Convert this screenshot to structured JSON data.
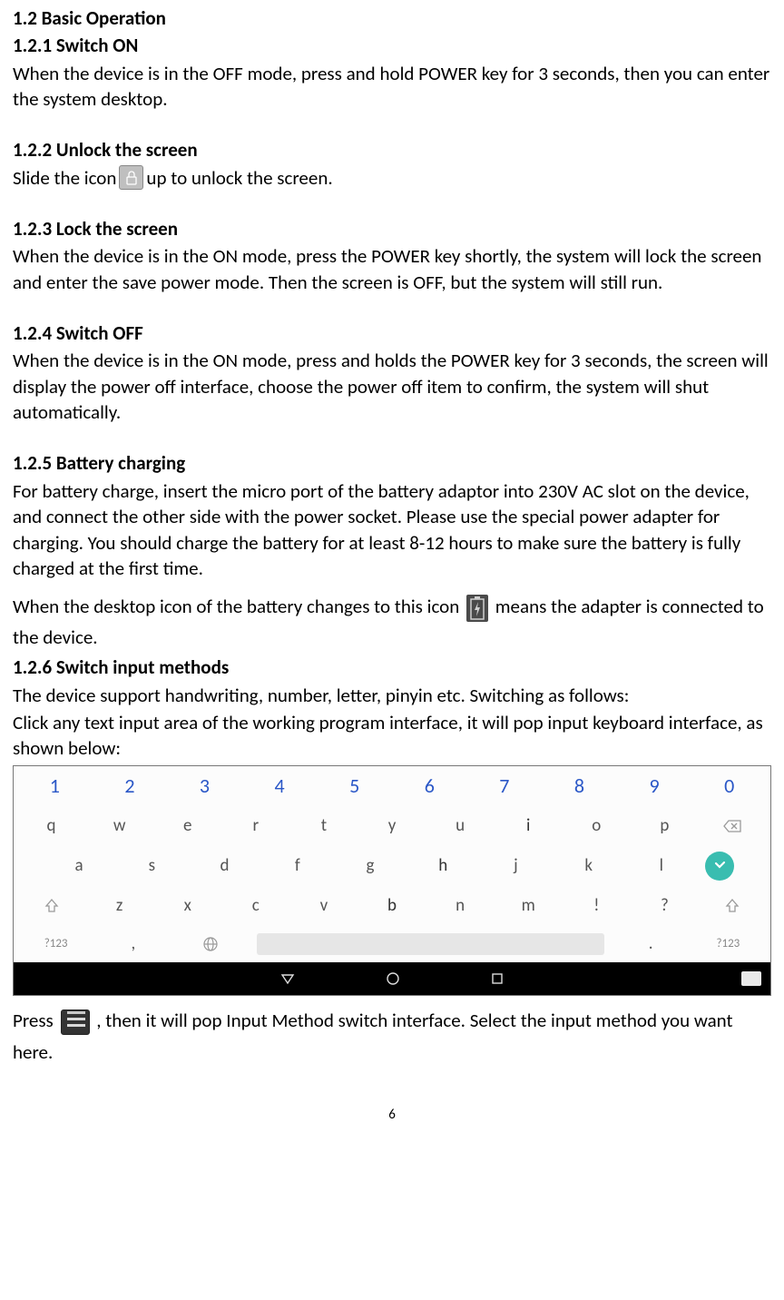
{
  "headings": {
    "h12": "1.2 Basic Operation",
    "h121": "1.2.1 Switch ON",
    "h122": "1.2.2 Unlock the screen",
    "h123": "1.2.3 Lock the screen",
    "h124": "1.2.4 Switch OFF",
    "h125": "1.2.5 Battery charging",
    "h126": "1.2.6 Switch input methods"
  },
  "text": {
    "p121": "When the device is in the OFF mode, press and hold POWER key for 3 seconds, then you can enter the system desktop.",
    "p122a": "Slide the icon",
    "p122b": " up to unlock the screen.",
    "p123": "When the device is in the ON mode, press the POWER key shortly, the system will lock the screen and enter the save power mode. Then the screen is OFF, but the system will still run.",
    "p124": "When the device is in the ON mode, press and holds the POWER key for 3 seconds, the screen will display the power off interface, choose the power off item to confirm, the system will shut automatically.",
    "p125a": "For battery charge, insert the micro port of the battery adaptor into 230V AC slot on the device, and connect the other side with the power socket. Please use the special power adapter for charging. You should charge the battery for at least 8-12 hours to make sure the battery is fully charged at the first time.",
    "p125b_pre": "When the desktop icon of the battery changes to this icon ",
    "p125b_post": " means the adapter is connected to the device.",
    "p126a": "The device support handwriting, number, letter, pinyin etc. Switching as follows:",
    "p126b": "Click any text input area of the working program interface, it will pop input keyboard interface, as shown below:",
    "p_press_pre": "Press",
    "p_press_post": ", then it will pop Input Method switch interface. Select the input method you want here."
  },
  "keyboard": {
    "numbers": [
      "1",
      "2",
      "3",
      "4",
      "5",
      "6",
      "7",
      "8",
      "9",
      "0"
    ],
    "row1": [
      "q",
      "w",
      "e",
      "r",
      "t",
      "y",
      "u",
      "i",
      "o",
      "p"
    ],
    "row2": [
      "a",
      "s",
      "d",
      "f",
      "g",
      "h",
      "j",
      "k",
      "l"
    ],
    "row3": [
      "z",
      "x",
      "c",
      "v",
      "b",
      "n",
      "m",
      "!",
      "?"
    ],
    "sym": "?123",
    "comma": ",",
    "period": "."
  },
  "page": "6"
}
